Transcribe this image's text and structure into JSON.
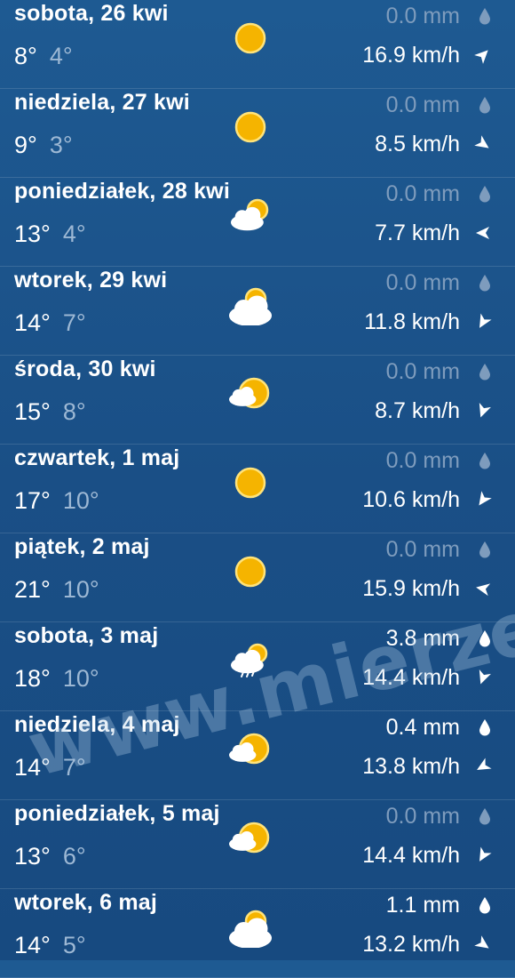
{
  "forecast": [
    {
      "day": "sobota, 26 kwi",
      "tmax": "8°",
      "tmin": "4°",
      "precip": "0.0 mm",
      "wind": "16.9 km/h",
      "icon": "sun-icon",
      "wind_dir_deg": 45
    },
    {
      "day": "niedziela, 27 kwi",
      "tmax": "9°",
      "tmin": "3°",
      "precip": "0.0 mm",
      "wind": "8.5 km/h",
      "icon": "sun-icon",
      "wind_dir_deg": 125
    },
    {
      "day": "poniedziałek, 28 kwi",
      "tmax": "13°",
      "tmin": "4°",
      "precip": "0.0 mm",
      "wind": "7.7 km/h",
      "icon": "partly-cloudy-icon",
      "wind_dir_deg": 270
    },
    {
      "day": "wtorek, 29 kwi",
      "tmax": "14°",
      "tmin": "7°",
      "precip": "0.0 mm",
      "wind": "11.8 km/h",
      "icon": "cloudy-sun-icon",
      "wind_dir_deg": 210
    },
    {
      "day": "środa, 30 kwi",
      "tmax": "15°",
      "tmin": "8°",
      "precip": "0.0 mm",
      "wind": "8.7 km/h",
      "icon": "mostly-sunny-icon",
      "wind_dir_deg": 200
    },
    {
      "day": "czwartek, 1 maj",
      "tmax": "17°",
      "tmin": "10°",
      "precip": "0.0 mm",
      "wind": "10.6 km/h",
      "icon": "sun-icon",
      "wind_dir_deg": 215
    },
    {
      "day": "piątek, 2 maj",
      "tmax": "21°",
      "tmin": "10°",
      "precip": "0.0 mm",
      "wind": "15.9 km/h",
      "icon": "sun-icon",
      "wind_dir_deg": 280
    },
    {
      "day": "sobota, 3 maj",
      "tmax": "18°",
      "tmin": "10°",
      "precip": "3.8 mm",
      "wind": "14.4 km/h",
      "icon": "rain-icon",
      "wind_dir_deg": 200,
      "wet": true
    },
    {
      "day": "niedziela, 4 maj",
      "tmax": "14°",
      "tmin": "7°",
      "precip": "0.4 mm",
      "wind": "13.8 km/h",
      "icon": "mostly-sunny-icon",
      "wind_dir_deg": 240,
      "wet": true
    },
    {
      "day": "poniedziałek, 5 maj",
      "tmax": "13°",
      "tmin": "6°",
      "precip": "0.0 mm",
      "wind": "14.4 km/h",
      "icon": "mostly-sunny-icon",
      "wind_dir_deg": 210
    },
    {
      "day": "wtorek, 6 maj",
      "tmax": "14°",
      "tmin": "5°",
      "precip": "1.1 mm",
      "wind": "13.2 km/h",
      "icon": "cloudy-sun-icon",
      "wind_dir_deg": 125,
      "wet": true
    }
  ],
  "watermark": "www.mierzeja.pl",
  "colors": {
    "sun": "#f5b400",
    "sun_stroke": "#ffe37a",
    "cloud": "#ffffff",
    "muted": "#7e9cbd",
    "background": "#1a4f86"
  }
}
